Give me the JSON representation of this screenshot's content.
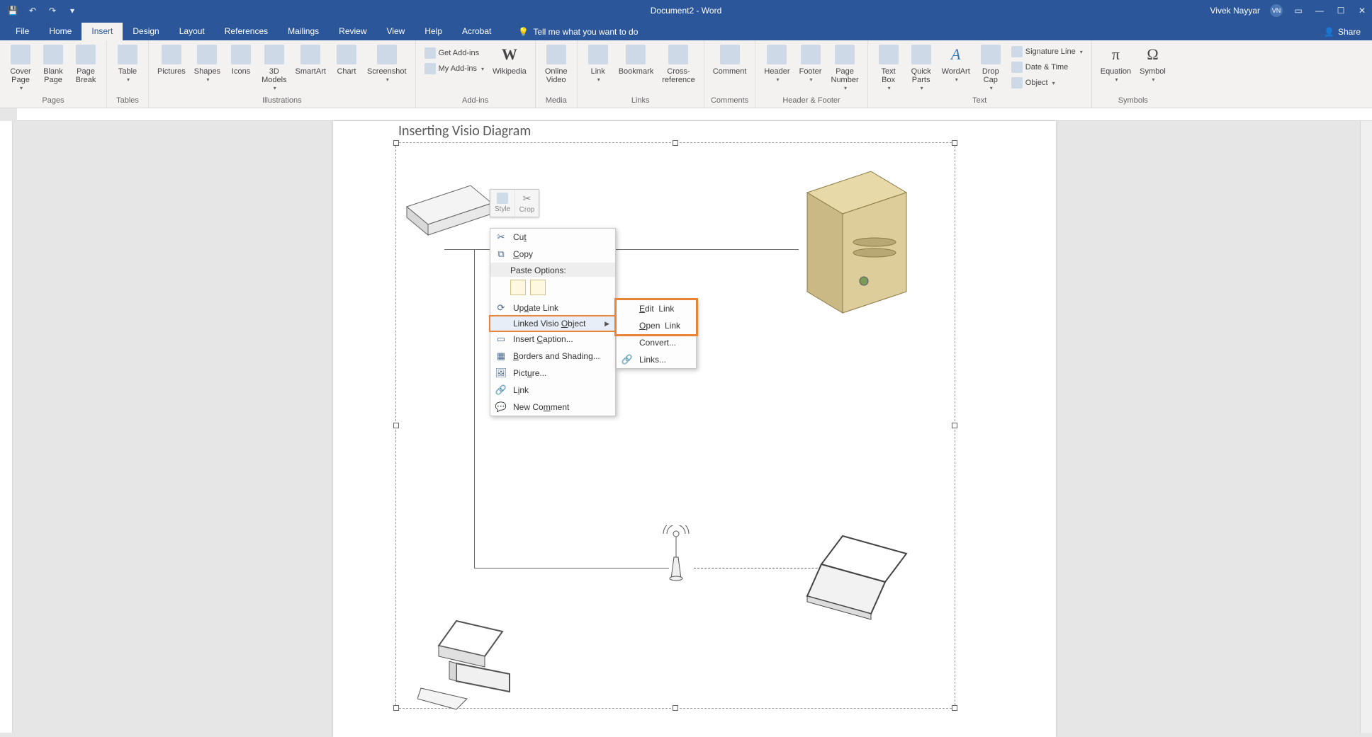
{
  "titlebar": {
    "doc_title": "Document2 - Word",
    "user_name": "Vivek Nayyar",
    "avatar_initials": "VN",
    "qa": {
      "save": "💾",
      "undo": "↶",
      "redo": "↷",
      "custom": "▾"
    }
  },
  "tabs": {
    "items": [
      "File",
      "Home",
      "Insert",
      "Design",
      "Layout",
      "References",
      "Mailings",
      "Review",
      "View",
      "Help",
      "Acrobat"
    ],
    "active": "Insert",
    "tell_me_placeholder": "Tell me what you want to do",
    "share": "Share"
  },
  "ribbon": {
    "groups": {
      "pages": {
        "label": "Pages",
        "cover": "Cover\nPage",
        "blank": "Blank\nPage",
        "break": "Page\nBreak"
      },
      "tables": {
        "label": "Tables",
        "table": "Table"
      },
      "illustrations": {
        "label": "Illustrations",
        "pictures": "Pictures",
        "shapes": "Shapes",
        "icons": "Icons",
        "models": "3D\nModels",
        "smartart": "SmartArt",
        "chart": "Chart",
        "screenshot": "Screenshot"
      },
      "addins": {
        "label": "Add-ins",
        "get": "Get Add-ins",
        "my": "My Add-ins",
        "wikipedia": "Wikipedia"
      },
      "media": {
        "label": "Media",
        "video": "Online\nVideo"
      },
      "links": {
        "label": "Links",
        "link": "Link",
        "bookmark": "Bookmark",
        "crossref": "Cross-\nreference"
      },
      "comments": {
        "label": "Comments",
        "comment": "Comment"
      },
      "hf": {
        "label": "Header & Footer",
        "header": "Header",
        "footer": "Footer",
        "pagenum": "Page\nNumber"
      },
      "text": {
        "label": "Text",
        "textbox": "Text\nBox",
        "quickparts": "Quick\nParts",
        "wordart": "WordArt",
        "dropcap": "Drop\nCap",
        "sigline": "Signature Line",
        "datetime": "Date & Time",
        "object": "Object"
      },
      "symbols": {
        "label": "Symbols",
        "equation": "Equation",
        "symbol": "Symbol"
      }
    }
  },
  "document": {
    "heading": "Inserting Visio Diagram"
  },
  "mini_toolbar": {
    "style": "Style",
    "crop": "Crop"
  },
  "context_menu": {
    "cut": "Cut",
    "copy": "Copy",
    "paste_header": "Paste Options:",
    "update_link": "Update Link",
    "linked_visio": "Linked Visio Object",
    "insert_caption": "Insert Caption...",
    "borders": "Borders and Shading...",
    "picture": "Picture...",
    "link": "Link",
    "new_comment": "New Comment"
  },
  "submenu": {
    "edit": "Edit  Link",
    "open": "Open  Link",
    "convert": "Convert...",
    "links": "Links..."
  }
}
